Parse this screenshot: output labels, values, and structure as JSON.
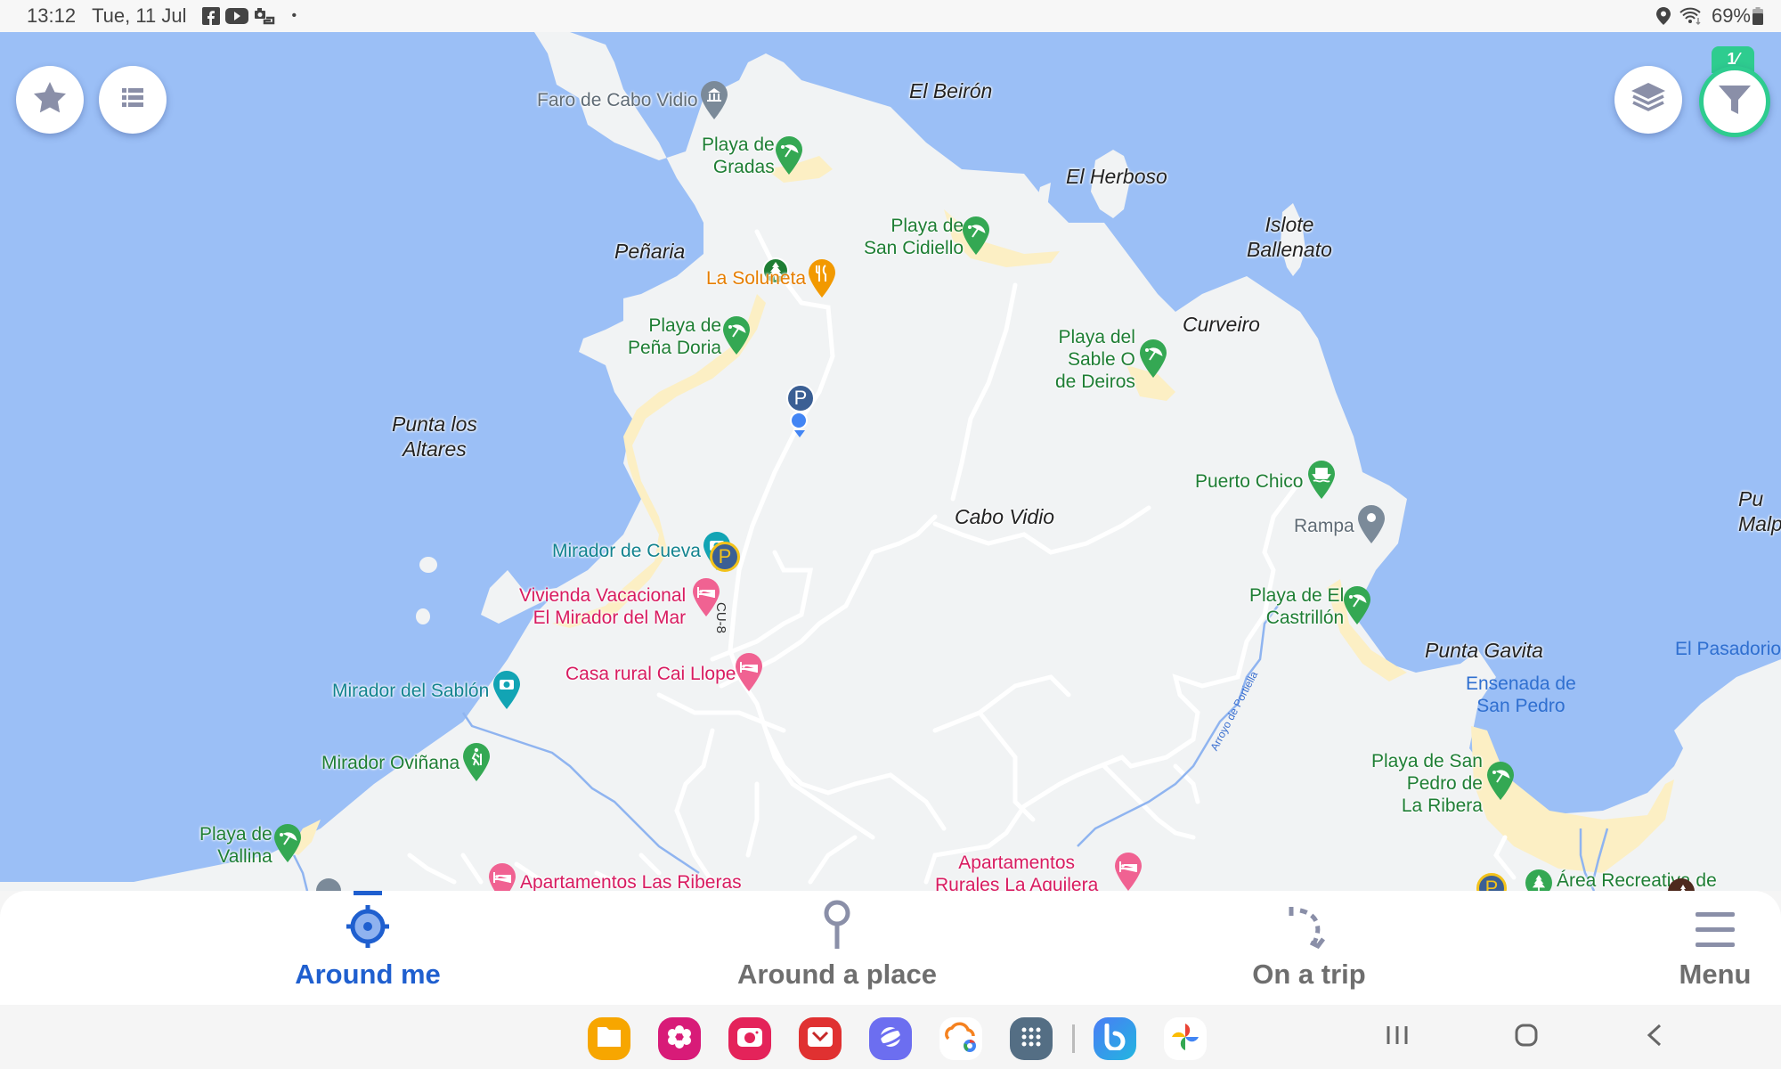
{
  "status_bar": {
    "time": "13:12",
    "date": "Tue, 11 Jul",
    "notification_icons": [
      "facebook-icon",
      "youtube-icon",
      "screen-share-icon",
      "more-dot-icon"
    ],
    "battery": "69%",
    "system_icons": [
      "location-icon",
      "wifi-icon",
      "battery-icon"
    ]
  },
  "map": {
    "place_labels": [
      {
        "id": "el-beiron",
        "text": "El Beirón"
      },
      {
        "id": "el-herboso",
        "text": "El Herboso"
      },
      {
        "id": "islote-ballenato",
        "text": "Islote\nBallenato"
      },
      {
        "id": "penaria",
        "text": "Peñaria"
      },
      {
        "id": "curveiro",
        "text": "Curveiro"
      },
      {
        "id": "punta-los-altares",
        "text": "Punta los\nAltares"
      },
      {
        "id": "cabo-vidio",
        "text": "Cabo Vidio"
      },
      {
        "id": "punta-gavita",
        "text": "Punta Gavita"
      },
      {
        "id": "punta-malp",
        "text": "Pu\nMalp"
      }
    ],
    "water_labels": [
      {
        "id": "el-pasadorio",
        "text": "El Pasadorio"
      },
      {
        "id": "ensenada-san-pedro",
        "text": "Ensenada de\nSan Pedro"
      }
    ],
    "road_labels": [
      {
        "id": "cu-8",
        "text": "CU-8"
      },
      {
        "id": "arroyo-portiella",
        "text": "Arroyo de Portiella"
      }
    ],
    "pois": [
      {
        "id": "faro-cabo-vidio",
        "text": "Faro de Cabo Vidio",
        "category": "museum",
        "icon": "museum-icon"
      },
      {
        "id": "playa-gradas",
        "text": "Playa de\nGradas",
        "category": "beach",
        "icon": "beach-umbrella-icon"
      },
      {
        "id": "playa-san-cidiello",
        "text": "Playa de\nSan Cidiello",
        "category": "beach",
        "icon": "beach-umbrella-icon"
      },
      {
        "id": "la-soluneta",
        "text": "La Soluneta",
        "category": "restaurant",
        "icon": "fork-knife-icon"
      },
      {
        "id": "playa-pena-doria",
        "text": "Playa de\nPeña Doria",
        "category": "beach",
        "icon": "beach-umbrella-icon"
      },
      {
        "id": "playa-sable-deiros",
        "text": "Playa del\nSable O\nde Deiros",
        "category": "beach",
        "icon": "beach-umbrella-icon"
      },
      {
        "id": "puerto-chico",
        "text": "Puerto Chico",
        "category": "marina",
        "icon": "boat-icon"
      },
      {
        "id": "rampa",
        "text": "Rampa",
        "category": "generic",
        "icon": "map-pin-icon"
      },
      {
        "id": "playa-castrillon",
        "text": "Playa de El\nCastrillón",
        "category": "beach",
        "icon": "beach-umbrella-icon"
      },
      {
        "id": "mirador-cueva",
        "text": "Mirador de Cueva",
        "category": "viewpoint",
        "icon": "camera-icon"
      },
      {
        "id": "vivienda-vacacional",
        "text": "Vivienda Vacacional\nEl Mirador del Mar",
        "category": "lodging",
        "icon": "bed-icon"
      },
      {
        "id": "casa-rural",
        "text": "Casa rural Cai Llope",
        "category": "lodging",
        "icon": "bed-icon"
      },
      {
        "id": "mirador-sablon",
        "text": "Mirador del Sablón",
        "category": "viewpoint",
        "icon": "camera-icon"
      },
      {
        "id": "mirador-ovinana",
        "text": "Mirador Oviñana",
        "category": "hiking",
        "icon": "hiker-icon"
      },
      {
        "id": "playa-vallina",
        "text": "Playa de\nVallina",
        "category": "beach",
        "icon": "beach-umbrella-icon"
      },
      {
        "id": "apartamentos-riberas",
        "text": "Apartamentos Las Riberas",
        "category": "lodging",
        "icon": "bed-icon"
      },
      {
        "id": "apartamentos-aquilera",
        "text": "Apartamentos\nRurales La Aquilera",
        "category": "lodging",
        "icon": "bed-icon"
      },
      {
        "id": "playa-san-pedro",
        "text": "Playa de San\nPedro de\nLa Ribera",
        "category": "beach",
        "icon": "beach-umbrella-icon"
      },
      {
        "id": "area-recreativa",
        "text": "Área Recreativa de",
        "category": "park",
        "icon": "tree-icon"
      }
    ],
    "markers": [
      {
        "id": "park-tree",
        "icon": "tree-icon"
      },
      {
        "id": "parking-1",
        "text": "P",
        "icon": "parking-icon"
      },
      {
        "id": "parking-2",
        "text": "P",
        "icon": "parking-icon"
      },
      {
        "id": "parking-3",
        "text": "P",
        "icon": "parking-icon"
      },
      {
        "id": "picnic",
        "icon": "picnic-icon"
      },
      {
        "id": "current-location",
        "icon": "current-location-dot"
      }
    ],
    "filter_badge": "1⁄",
    "colors": {
      "water": "#9bbff6",
      "land": "#f1f3f4",
      "beach": "#fcefc4",
      "accent": "#2ecc8f"
    }
  },
  "map_buttons": {
    "favorites": "star-icon",
    "list": "list-icon",
    "layers": "layers-icon",
    "filter": "filter-icon"
  },
  "bottom_nav": {
    "active": "around-me",
    "items": [
      {
        "id": "around-me",
        "label": "Around me",
        "icon": "crosshair-icon"
      },
      {
        "id": "around-a-place",
        "label": "Around a place",
        "icon": "pin-icon"
      },
      {
        "id": "on-a-trip",
        "label": "On a trip",
        "icon": "route-icon"
      },
      {
        "id": "menu",
        "label": "Menu",
        "icon": "hamburger-icon"
      }
    ]
  },
  "taskbar": {
    "apps": [
      {
        "name": "My Files",
        "icon": "folder-icon",
        "color": "#f7a600"
      },
      {
        "name": "Blossom",
        "icon": "flower-icon",
        "color": "#d81b78"
      },
      {
        "name": "Camera",
        "icon": "camera-app-icon",
        "color": "#e4235a"
      },
      {
        "name": "Email",
        "icon": "email-icon",
        "color": "#e03131"
      },
      {
        "name": "Internet",
        "icon": "samsung-internet-icon",
        "color": "#6c6ef0"
      },
      {
        "name": "Cloud",
        "icon": "cloud-chrome-icon",
        "color": "#ffffff"
      },
      {
        "name": "Apps",
        "icon": "app-grid-icon",
        "color": "#546e84"
      },
      {
        "name": "Bixby",
        "icon": "bixby-icon",
        "color": "#2f8cf0"
      },
      {
        "name": "Photos",
        "icon": "google-photos-icon",
        "color": "#ffffff"
      }
    ],
    "system_buttons": [
      "recents-icon",
      "home-icon",
      "back-icon"
    ]
  }
}
